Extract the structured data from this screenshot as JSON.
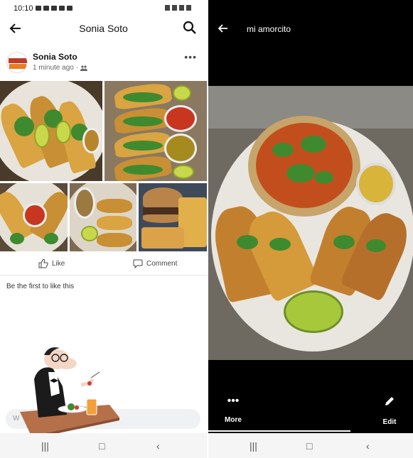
{
  "left": {
    "status": {
      "time": "10:10"
    },
    "header": {
      "title": "Sonia Soto"
    },
    "post": {
      "author": "Sonia Soto",
      "timestamp": "1 minute ago",
      "avatar_text": "TACTOX",
      "actions": {
        "like": "Like",
        "comment": "Comment"
      },
      "likes_text": "Be the first to like this"
    },
    "comment_input": {
      "placeholder": "W"
    }
  },
  "right": {
    "title": "mi amorcito",
    "more_label": "More",
    "edit_label": "Edit"
  },
  "colors": {
    "dark_bg": "#000000",
    "text_primary": "#111111",
    "text_secondary": "#666666"
  }
}
